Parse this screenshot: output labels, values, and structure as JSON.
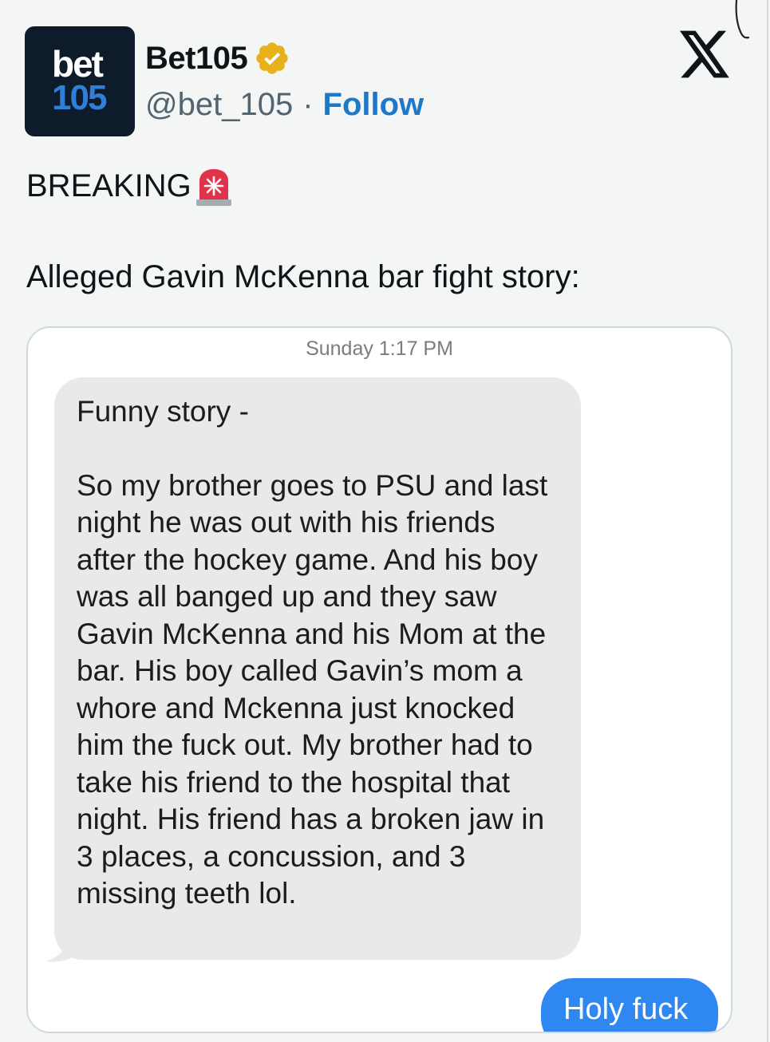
{
  "tweet": {
    "avatar": {
      "line1": "bet",
      "line2": "105"
    },
    "display_name": "Bet105",
    "handle": "@bet_105",
    "separator": "·",
    "follow_label": "Follow",
    "line1": "BREAKING",
    "line2": "Alleged Gavin McKenna bar fight story:"
  },
  "icons": {
    "verified": "verified-badge-icon",
    "platform": "x-logo-icon",
    "siren": "police-siren-icon"
  },
  "colors": {
    "follow": "#1d78c9",
    "verified_badge": "#e8b11c",
    "incoming_bubble": "#e9e9eb",
    "outgoing_bubble": "#2f88f2",
    "avatar_bg": "#0d1b2a",
    "avatar_105": "#2f7fd8"
  },
  "screenshot": {
    "timestamp": "Sunday 1:17 PM",
    "incoming_message": {
      "opening": "Funny story -",
      "body": "So my brother goes to PSU and last night he was out with his friends after the hockey game. And his boy was all banged up and they saw Gavin McKenna and his Mom at the bar. His boy called Gavin’s mom a whore and Mckenna just knocked him the fuck out. My brother had to take his friend to the hospital that night. His friend has a broken jaw in 3 places, a concussion, and 3 missing teeth lol."
    },
    "outgoing_message": "Holy fuck"
  }
}
